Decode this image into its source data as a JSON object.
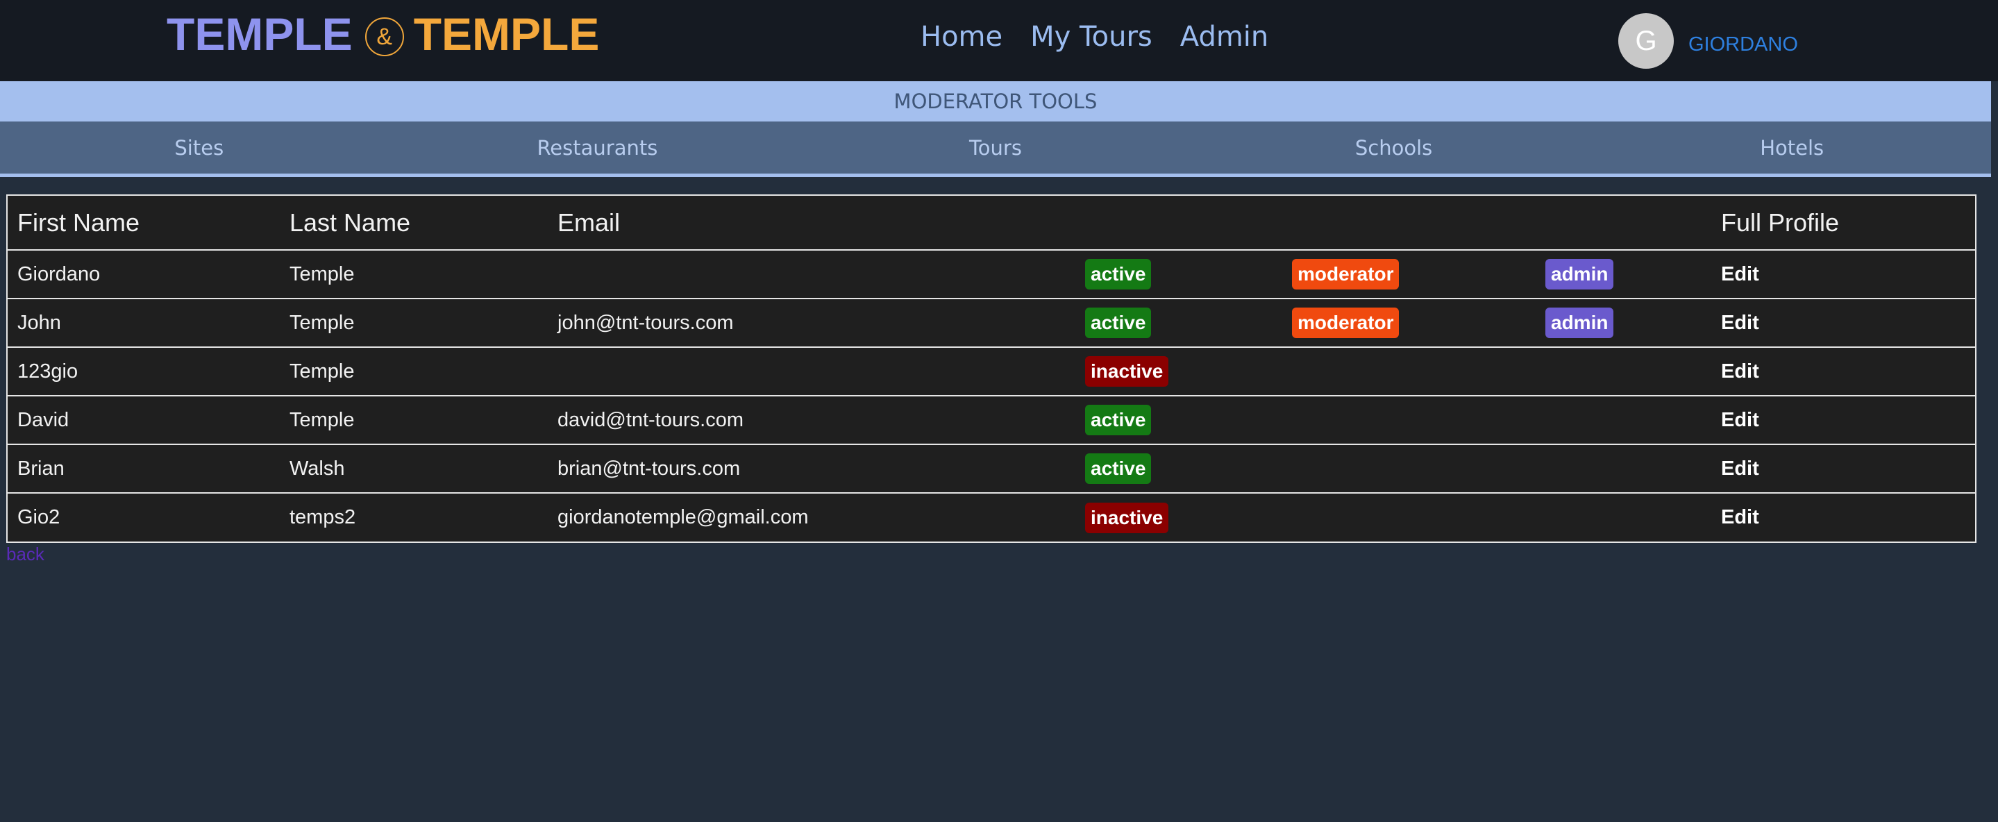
{
  "header": {
    "logo_word1": "TEMPLE",
    "logo_amp": "&",
    "logo_word2": "TEMPLE",
    "nav": [
      "Home",
      "My Tours",
      "Admin"
    ],
    "avatar_initial": "G",
    "username": "GIORDANO"
  },
  "moderator": {
    "title": "MODERATOR TOOLS",
    "links": [
      "Sites",
      "Restaurants",
      "Tours",
      "Schools",
      "Hotels"
    ]
  },
  "table": {
    "headers": {
      "first_name": "First Name",
      "last_name": "Last Name",
      "email": "Email",
      "full_profile": "Full Profile"
    },
    "rows": [
      {
        "first": "Giordano",
        "last": "Temple",
        "email": "",
        "status": "active",
        "moderator": "moderator",
        "admin": "admin",
        "edit": "Edit"
      },
      {
        "first": "John",
        "last": "Temple",
        "email": "john@tnt-tours.com",
        "status": "active",
        "moderator": "moderator",
        "admin": "admin",
        "edit": "Edit"
      },
      {
        "first": "123gio",
        "last": "Temple",
        "email": "",
        "status": "inactive",
        "moderator": "",
        "admin": "",
        "edit": "Edit"
      },
      {
        "first": "David",
        "last": "Temple",
        "email": "david@tnt-tours.com",
        "status": "active",
        "moderator": "",
        "admin": "",
        "edit": "Edit"
      },
      {
        "first": "Brian",
        "last": "Walsh",
        "email": "brian@tnt-tours.com",
        "status": "active",
        "moderator": "",
        "admin": "",
        "edit": "Edit"
      },
      {
        "first": "Gio2",
        "last": "temps2",
        "email": "giordanotemple@gmail.com",
        "status": "inactive",
        "moderator": "",
        "admin": "",
        "edit": "Edit"
      }
    ]
  },
  "back_link": "back",
  "colors": {
    "active": "#147a14",
    "inactive": "#8b0000",
    "moderator": "#f04a0f",
    "admin": "#6a5acd"
  }
}
